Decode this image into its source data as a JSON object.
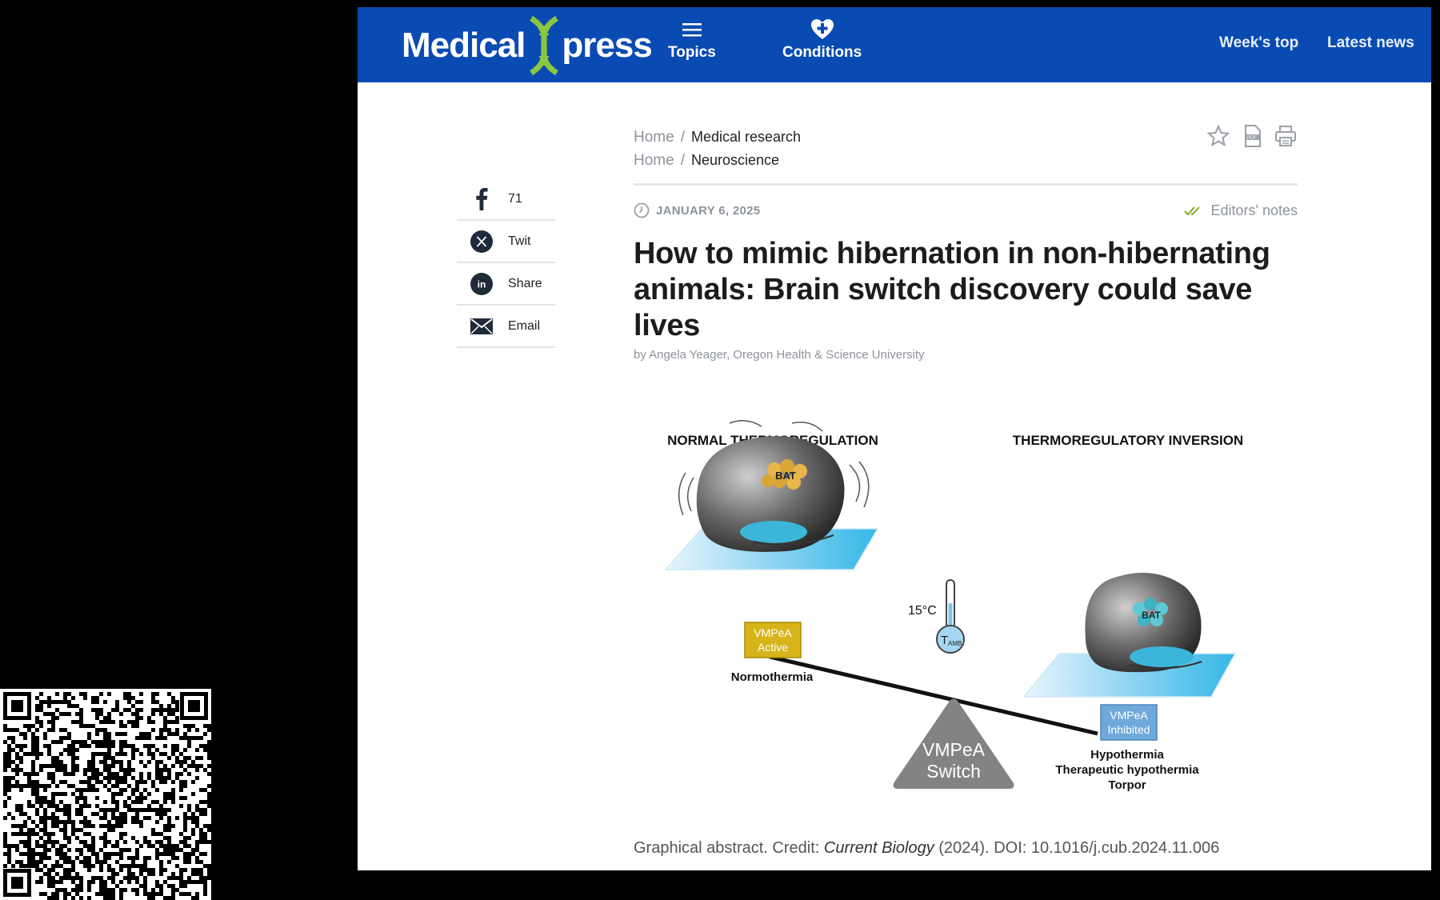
{
  "site": {
    "logo_left": "Medical",
    "logo_right": "press",
    "nav": {
      "topics": "Topics",
      "conditions": "Conditions",
      "weeks_top": "Week's top",
      "latest_news": "Latest news"
    }
  },
  "breadcrumbs": [
    {
      "home": "Home",
      "separator": "/",
      "current": "Medical research"
    },
    {
      "home": "Home",
      "separator": "/",
      "current": "Neuroscience"
    }
  ],
  "share": {
    "facebook_count": "71",
    "twitter": "Twit",
    "linkedin": "Share",
    "email": "Email"
  },
  "article": {
    "date": "JANUARY 6, 2025",
    "editors_notes": "Editors' notes",
    "title": "How to mimic hibernation in non-hibernating animals: Brain switch discovery could save lives",
    "byline": "by Angela Yeager, Oregon Health & Science University"
  },
  "figure": {
    "left_heading": "NORMAL THERMOREGULATION",
    "right_heading": "THERMOREGULATORY INVERSION",
    "bat_left": "BAT",
    "bat_right": "BAT",
    "temperature": "15°C",
    "tamb_t": "T",
    "tamb_sub": "AMB",
    "active_line1": "VMPeA",
    "active_line2": "Active",
    "normothermia": "Normothermia",
    "inhibited_line1": "VMPeA",
    "inhibited_line2": "Inhibited",
    "switch_line1": "VMPeA",
    "switch_line2": "Switch",
    "outcome_1": "Hypothermia",
    "outcome_2": "Therapeutic hypothermia",
    "outcome_3": "Torpor"
  },
  "caption": {
    "prefix": "Graphical abstract. Credit: ",
    "journal": "Current Biology",
    "suffix": " (2024). DOI: 10.1016/j.cub.2024.11.006"
  },
  "colors": {
    "header_blue": "#0a4bb3",
    "logo_green": "#8cc63f",
    "active_yellow": "#d7b51a",
    "inhibited_blue": "#6fa9dc",
    "pad_cyan": "#35b8e6"
  }
}
